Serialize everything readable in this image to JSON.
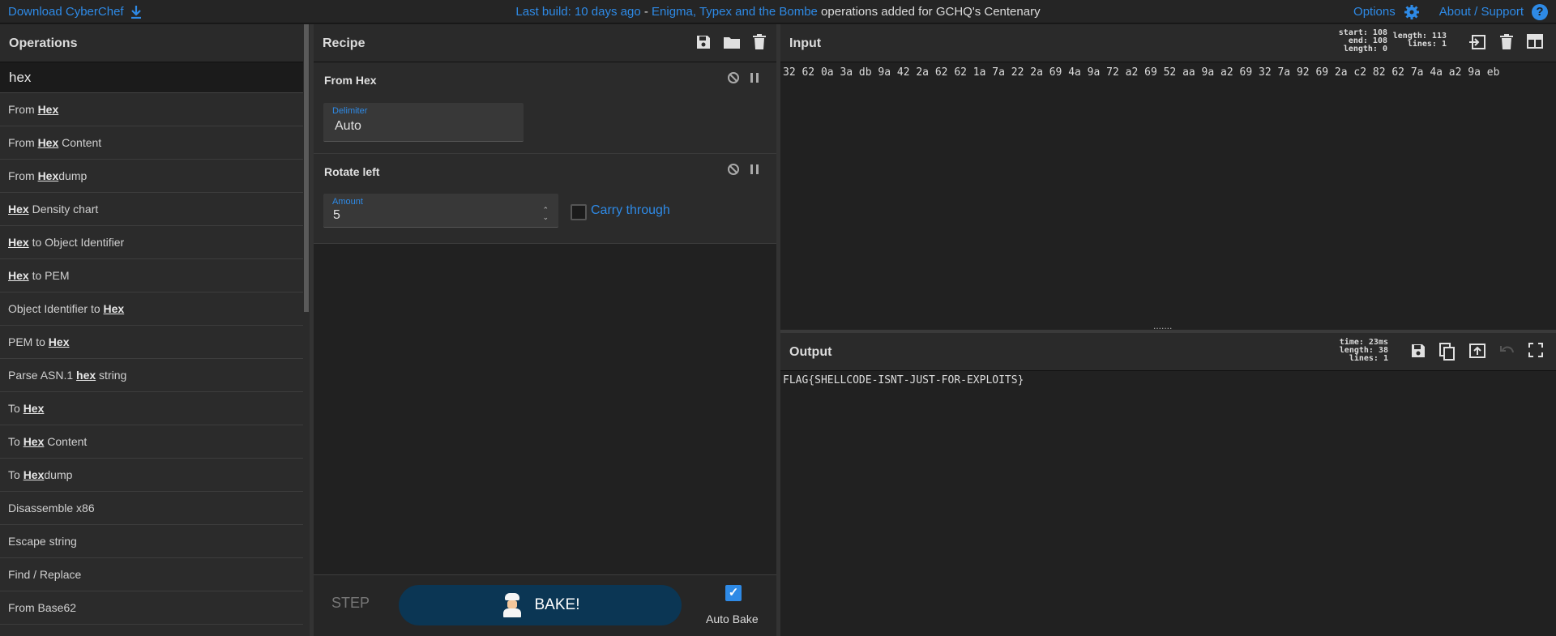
{
  "banner": {
    "download": "Download CyberChef",
    "last_build": "Last build: 10 days ago",
    "separator": " - ",
    "news_link": "Enigma, Typex and the Bombe",
    "news_text": " operations added for GCHQ's Centenary",
    "options": "Options",
    "about": "About / Support"
  },
  "operations": {
    "title": "Operations",
    "search_value": "hex",
    "items": [
      {
        "pre": "From ",
        "hl": "Hex",
        "post": ""
      },
      {
        "pre": "From ",
        "hl": "Hex",
        "post": " Content"
      },
      {
        "pre": "From ",
        "hl": "Hex",
        "post": "dump"
      },
      {
        "pre": "",
        "hl": "Hex",
        "post": " Density chart"
      },
      {
        "pre": "",
        "hl": "Hex",
        "post": " to Object Identifier"
      },
      {
        "pre": "",
        "hl": "Hex",
        "post": " to PEM"
      },
      {
        "pre": "Object Identifier to ",
        "hl": "Hex",
        "post": ""
      },
      {
        "pre": "PEM to ",
        "hl": "Hex",
        "post": ""
      },
      {
        "pre": "Parse ASN.1 ",
        "hl": "hex",
        "post": " string"
      },
      {
        "pre": "To ",
        "hl": "Hex",
        "post": ""
      },
      {
        "pre": "To ",
        "hl": "Hex",
        "post": " Content"
      },
      {
        "pre": "To ",
        "hl": "Hex",
        "post": "dump"
      },
      {
        "pre": "Disassemble x86",
        "hl": "",
        "post": ""
      },
      {
        "pre": "Escape string",
        "hl": "",
        "post": ""
      },
      {
        "pre": "Find / Replace",
        "hl": "",
        "post": ""
      },
      {
        "pre": "From Base62",
        "hl": "",
        "post": ""
      }
    ]
  },
  "recipe": {
    "title": "Recipe",
    "ops": [
      {
        "name": "From Hex",
        "field_label": "Delimiter",
        "field_value": "Auto"
      },
      {
        "name": "Rotate left",
        "field_label": "Amount",
        "field_value": "5",
        "checkbox_label": "Carry through"
      }
    ],
    "step": "STEP",
    "bake": "BAKE!",
    "auto_bake": "Auto Bake"
  },
  "input": {
    "title": "Input",
    "stats_sel": [
      "start: 108",
      "end: 108",
      "length:   0"
    ],
    "stats_len": [
      "length: 113",
      "lines:   1"
    ],
    "text": "32 62 0a 3a db 9a 42 2a 62 62 1a 7a 22 2a 69 4a 9a 72 a2 69 52 aa 9a a2 69 32 7a 92 69 2a c2 82 62 7a 4a a2 9a eb"
  },
  "output": {
    "title": "Output",
    "stats": [
      "time: 23ms",
      "length:   38",
      "lines:    1"
    ],
    "text": "FLAG{SHELLCODE-ISNT-JUST-FOR-EXPLOITS}"
  },
  "colors": {
    "accent": "#2e8ae6",
    "bake": "#0b3654"
  }
}
